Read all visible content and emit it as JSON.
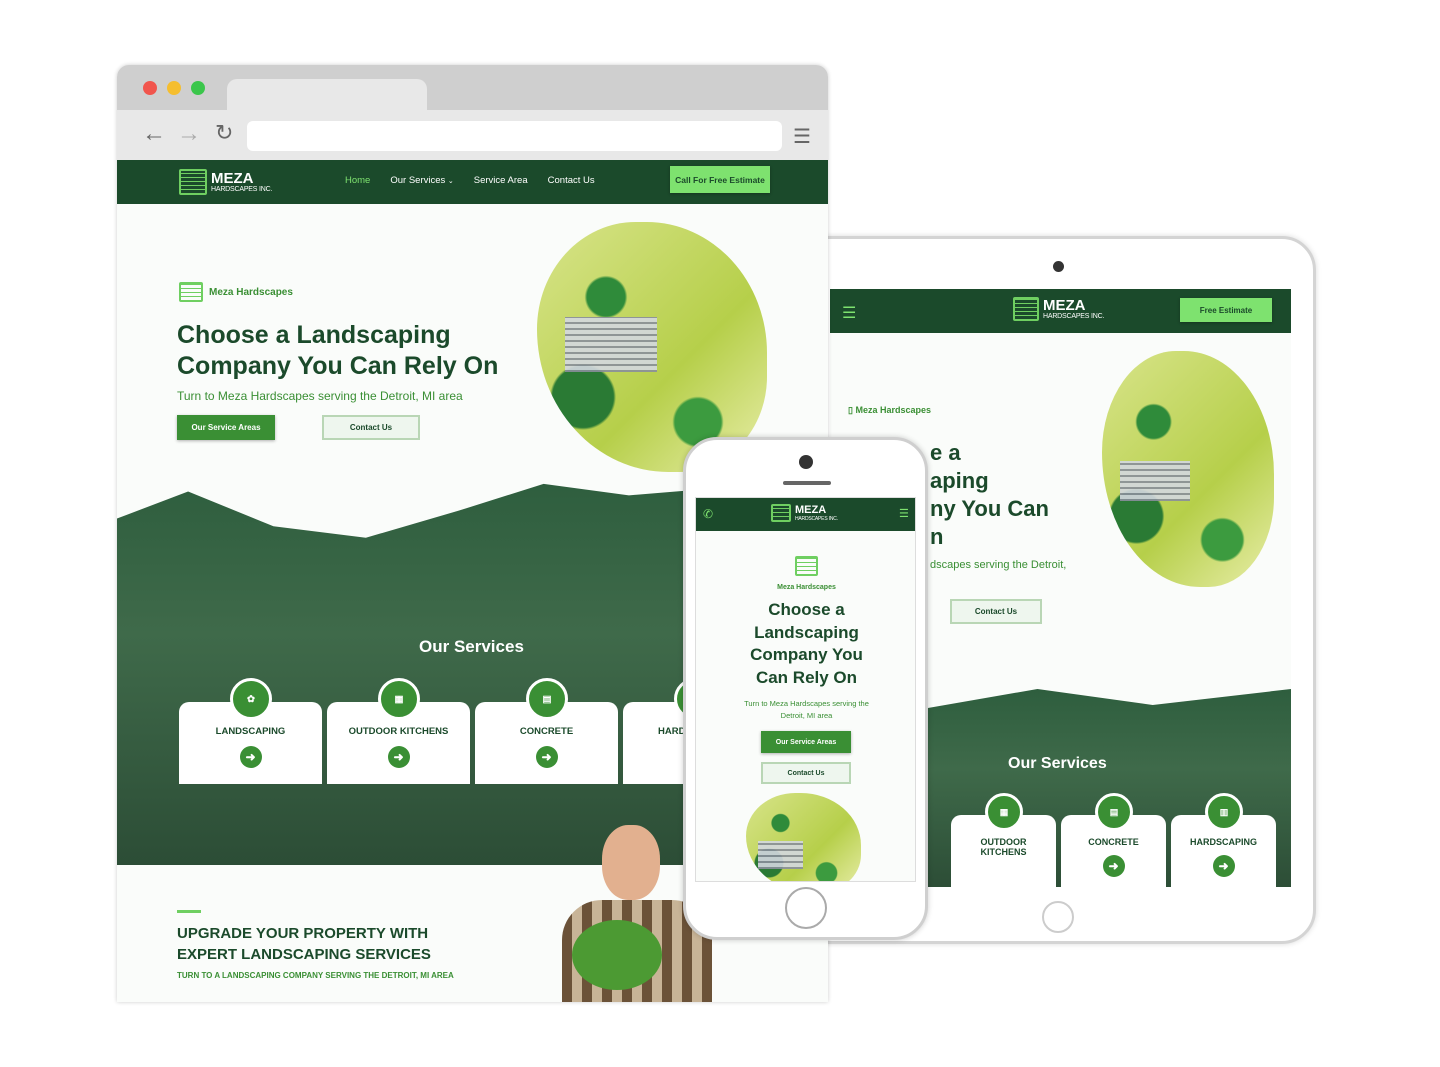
{
  "brand": {
    "name": "MEZA",
    "sub": "HARDSCAPES INC.",
    "tagline": "Meza Hardscapes"
  },
  "colors": {
    "dark_green": "#1b4a2b",
    "accent_green": "#3a8f34",
    "cta_green": "#7ee26f"
  },
  "desktop": {
    "nav": [
      {
        "label": "Home",
        "active": true
      },
      {
        "label": "Our Services",
        "dropdown": true
      },
      {
        "label": "Service Area"
      },
      {
        "label": "Contact Us"
      }
    ],
    "cta": "Call For Free Estimate",
    "hero": {
      "title_line1": "Choose a Landscaping",
      "title_line2": "Company You Can Rely On",
      "subtitle": "Turn to Meza Hardscapes serving the Detroit, MI area",
      "btn_primary": "Our Service Areas",
      "btn_secondary": "Contact Us"
    },
    "services_title": "Our Services",
    "services": [
      {
        "label": "LANDSCAPING",
        "icon": "plant-tools-icon"
      },
      {
        "label": "OUTDOOR KITCHENS",
        "icon": "grill-icon"
      },
      {
        "label": "CONCRETE",
        "icon": "mixer-icon"
      },
      {
        "label": "HARDSCAPING",
        "icon": "bricks-icon"
      }
    ],
    "upgrade": {
      "title_line1": "UPGRADE YOUR PROPERTY WITH",
      "title_line2": "EXPERT LANDSCAPING SERVICES",
      "subtitle": "TURN TO A LANDSCAPING COMPANY SERVING THE DETROIT, MI AREA"
    }
  },
  "tablet": {
    "cta": "Free Estimate",
    "hero": {
      "title_lines": [
        "e a",
        "aping",
        "ny You Can",
        "n"
      ],
      "subtitle": "dscapes serving the Detroit,",
      "btn_secondary": "Contact Us"
    },
    "services_title": "Our Services",
    "services": [
      {
        "label": "OUTDOOR KITCHENS"
      },
      {
        "label": "CONCRETE"
      },
      {
        "label": "HARDSCAPING"
      }
    ]
  },
  "phone": {
    "hero": {
      "title": "Choose a Landscaping Company You Can Rely On",
      "subtitle": "Turn to Meza Hardscapes serving the Detroit, MI area",
      "btn_primary": "Our Service Areas",
      "btn_secondary": "Contact Us"
    }
  }
}
